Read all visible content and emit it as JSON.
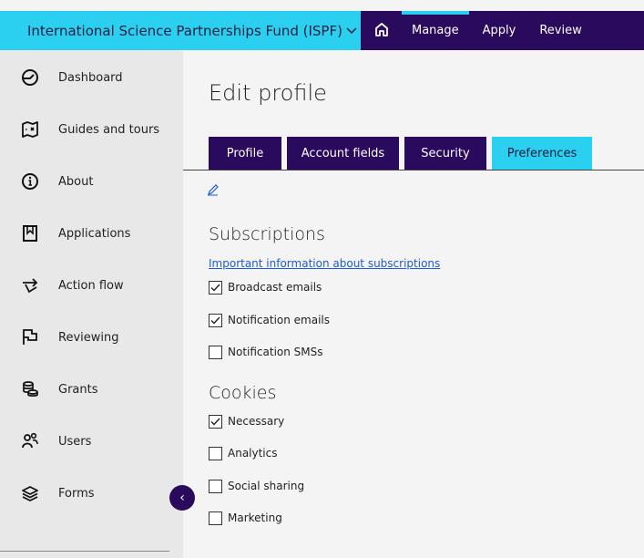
{
  "header": {
    "program": "International Science Partnerships Fund (ISPF)",
    "program_chevron_icon": "chevron-down-icon",
    "home_icon": "home-icon",
    "nav": [
      "Manage",
      "Apply",
      "Review"
    ],
    "colors": {
      "cyan": "#2bd0f0",
      "purple": "#2a0a5c"
    }
  },
  "sidebar": {
    "items": [
      {
        "label": "Dashboard",
        "icon": "dashboard-gauge-icon"
      },
      {
        "label": "Guides and tours",
        "icon": "map-icon"
      },
      {
        "label": "About",
        "icon": "info-icon"
      },
      {
        "label": "Applications",
        "icon": "bookmark-icon"
      },
      {
        "label": "Action flow",
        "icon": "flow-arrow-icon"
      },
      {
        "label": "Reviewing",
        "icon": "flag-icon"
      },
      {
        "label": "Grants",
        "icon": "coins-icon"
      },
      {
        "label": "Users",
        "icon": "users-icon"
      },
      {
        "label": "Forms",
        "icon": "layers-icon"
      }
    ],
    "collapse_glyph": "‹"
  },
  "main": {
    "title": "Edit profile",
    "tabs": [
      {
        "label": "Profile",
        "active": false
      },
      {
        "label": "Account fields",
        "active": false
      },
      {
        "label": "Security",
        "active": false
      },
      {
        "label": "Preferences",
        "active": true
      }
    ],
    "subscriptions": {
      "title": "Subscriptions",
      "link": "Important information about subscriptions",
      "options": [
        {
          "label": "Broadcast emails",
          "checked": true
        },
        {
          "label": "Notification emails",
          "checked": true
        },
        {
          "label": "Notification SMSs",
          "checked": false
        }
      ]
    },
    "cookies": {
      "title": "Cookies",
      "options": [
        {
          "label": "Necessary",
          "checked": true
        },
        {
          "label": "Analytics",
          "checked": false
        },
        {
          "label": "Social sharing",
          "checked": false
        },
        {
          "label": "Marketing",
          "checked": false
        }
      ]
    }
  }
}
